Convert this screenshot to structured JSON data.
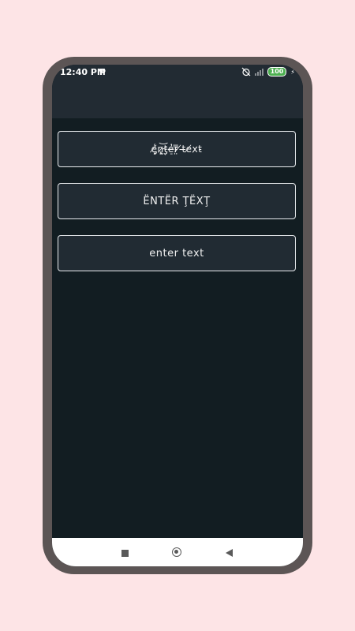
{
  "status_bar": {
    "time": "12:40 PM",
    "notification_icon": "P",
    "battery": "100",
    "icons": [
      "alarm-off-icon",
      "signal-icon",
      "battery-icon",
      "charging-icon"
    ]
  },
  "app_bar": {
    "title": ""
  },
  "text_boxes": [
    {
      "text": "e̸̡͓͑n̷̢͈͝t̴̡̖̒e̶̠̓r̵̤̿ ̸t̶e̸x̷t̵",
      "style": "zalgo"
    },
    {
      "text": "ËNTËR ŢËXŢ",
      "style": "diacritic-caps"
    },
    {
      "text": "enter text",
      "style": "small"
    }
  ],
  "nav_bar": {
    "icons": [
      "recent-apps-icon",
      "home-icon",
      "back-icon"
    ]
  },
  "colors": {
    "page_background": "#fde4e6",
    "phone_frame": "#5c5555",
    "screen_background": "#121d22",
    "app_bar": "#222b33",
    "box_border": "#e9ecef",
    "battery": "#4caf50"
  }
}
